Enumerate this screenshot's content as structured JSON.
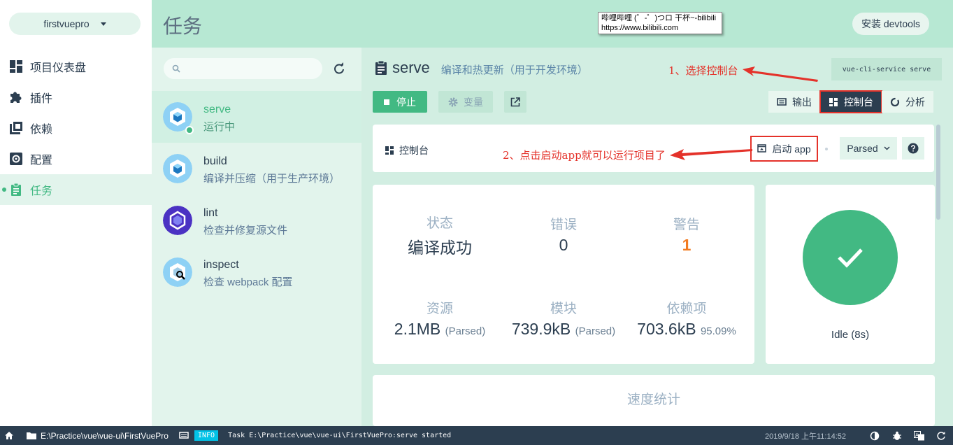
{
  "colors": {
    "accent": "#42b983",
    "dark": "#2c3e50",
    "annotation": "#e4322a",
    "warning": "#f27c22",
    "info": "#03c2e6"
  },
  "sidebar": {
    "project": "firstvuepro",
    "items": [
      {
        "label": "项目仪表盘",
        "icon": "dashboard-icon"
      },
      {
        "label": "插件",
        "icon": "puzzle-icon"
      },
      {
        "label": "依赖",
        "icon": "library-icon"
      },
      {
        "label": "配置",
        "icon": "settings-icon"
      },
      {
        "label": "任务",
        "icon": "clipboard-icon",
        "active": true
      }
    ]
  },
  "header": {
    "title": "任务",
    "devtools_label": "安装 devtools"
  },
  "tooltip": {
    "line1": "哔哩哔哩 (゜-゜)つロ 干杯~-bilibili",
    "line2": "https://www.bilibili.com"
  },
  "tasks": [
    {
      "name": "serve",
      "desc": "运行中",
      "icon": "webpack-icon",
      "active": true
    },
    {
      "name": "build",
      "desc": "编译并压缩（用于生产环境）",
      "icon": "webpack-icon"
    },
    {
      "name": "lint",
      "desc": "检查并修复源文件",
      "icon": "eslint-icon"
    },
    {
      "name": "inspect",
      "desc": "检查 webpack 配置",
      "icon": "webpack-inspect-icon"
    }
  ],
  "serve": {
    "title": "serve",
    "desc": "编译和热更新（用于开发环境）",
    "command": "vue-cli-service serve",
    "stop_label": "停止",
    "vars_label": "变量",
    "tabs": {
      "output": "输出",
      "console": "控制台",
      "analyze": "分析"
    }
  },
  "annotations": {
    "step1": "1、选择控制台",
    "step2": "2、点击启动app就可以运行项目了"
  },
  "console": {
    "label": "控制台",
    "start_app": "启动 app",
    "mode": "Parsed"
  },
  "stats": {
    "status_label": "状态",
    "status_value": "编译成功",
    "errors_label": "错误",
    "errors_value": "0",
    "warnings_label": "警告",
    "warnings_value": "1",
    "assets_label": "资源",
    "assets_value": "2.1MB",
    "assets_note": "(Parsed)",
    "modules_label": "模块",
    "modules_value": "739.9kB",
    "modules_note": "(Parsed)",
    "deps_label": "依赖项",
    "deps_value": "703.6kB",
    "deps_note": "95.09%"
  },
  "build_status": "Idle (8s)",
  "speed": {
    "title": "速度统计"
  },
  "statusbar": {
    "path": "E:\\Practice\\vue\\vue-ui\\FirstVuePro",
    "log_level": "INFO",
    "log_message": "Task E:\\Practice\\vue\\vue-ui\\FirstVuePro:serve started",
    "datetime": "2019/9/18 上午11:14:52"
  }
}
